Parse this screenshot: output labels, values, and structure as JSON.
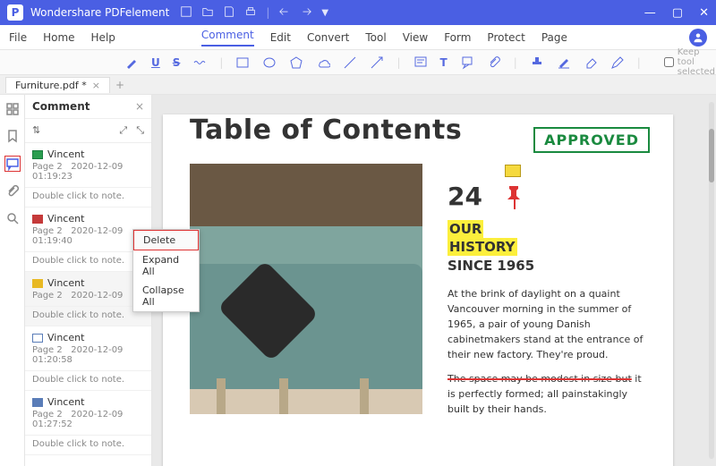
{
  "app": {
    "name": "Wondershare PDFelement"
  },
  "window": {
    "min": "—",
    "max": "▢",
    "close": "✕"
  },
  "menubar": [
    "File",
    "Home",
    "Help",
    "Comment",
    "Edit",
    "Convert",
    "Tool",
    "View",
    "Form",
    "Protect",
    "Page"
  ],
  "menubar_active": "Comment",
  "ribbon": {
    "keep_tool": "Keep tool selected"
  },
  "tab": {
    "name": "Furniture.pdf *"
  },
  "panel": {
    "title": "Comment"
  },
  "comments": [
    {
      "user": "Vincent",
      "page": "Page 2",
      "time": "2020-12-09 01:19:23",
      "note": "Double click to note.",
      "ic": "i-grn"
    },
    {
      "user": "Vincent",
      "page": "Page 2",
      "time": "2020-12-09 01:19:40",
      "note": "Double click to note.",
      "ic": "i-red"
    },
    {
      "user": "Vincent",
      "page": "Page 2",
      "time": "2020-12-09",
      "note": "Double click to note.",
      "ic": "i-yel",
      "sel": true
    },
    {
      "user": "Vincent",
      "page": "Page 2",
      "time": "2020-12-09 01:20:58",
      "note": "Double click to note.",
      "ic": "i-blu"
    },
    {
      "user": "Vincent",
      "page": "Page 2",
      "time": "2020-12-09 01:27:52",
      "note": "Double click to note.",
      "ic": "i-bl2"
    }
  ],
  "context_menu": {
    "delete": "Delete",
    "expand": "Expand All",
    "collapse": "Collapse All"
  },
  "doc": {
    "toc": "Table of Contents",
    "stamp": "APPROVED",
    "num": "24",
    "our": "OUR",
    "history": "HISTORY",
    "since": "SINCE 1965",
    "para1": "At the brink of daylight on a quaint Vancouver morning in the summer of 1965, a pair of young Danish cabinetmakers stand at the entrance of their new factory. They're proud.",
    "para2a": "The space may be modest in size but",
    "para2b": " it is perfectly formed; all painstakingly built by their hands."
  }
}
